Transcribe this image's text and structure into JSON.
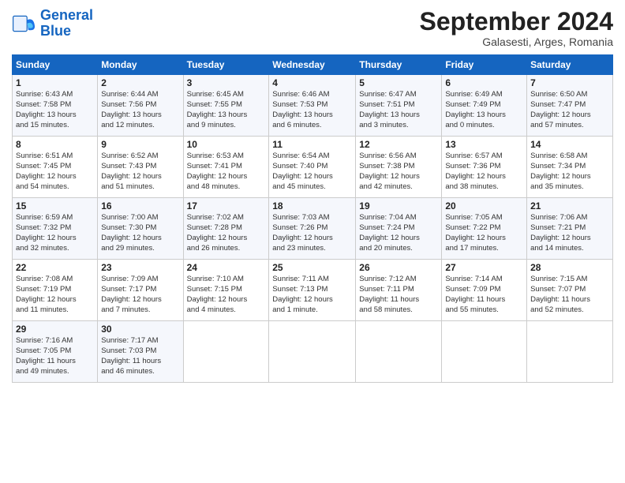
{
  "logo": {
    "line1": "General",
    "line2": "Blue"
  },
  "header": {
    "month": "September 2024",
    "location": "Galasesti, Arges, Romania"
  },
  "days_of_week": [
    "Sunday",
    "Monday",
    "Tuesday",
    "Wednesday",
    "Thursday",
    "Friday",
    "Saturday"
  ],
  "weeks": [
    [
      {
        "day": "1",
        "info": "Sunrise: 6:43 AM\nSunset: 7:58 PM\nDaylight: 13 hours\nand 15 minutes."
      },
      {
        "day": "2",
        "info": "Sunrise: 6:44 AM\nSunset: 7:56 PM\nDaylight: 13 hours\nand 12 minutes."
      },
      {
        "day": "3",
        "info": "Sunrise: 6:45 AM\nSunset: 7:55 PM\nDaylight: 13 hours\nand 9 minutes."
      },
      {
        "day": "4",
        "info": "Sunrise: 6:46 AM\nSunset: 7:53 PM\nDaylight: 13 hours\nand 6 minutes."
      },
      {
        "day": "5",
        "info": "Sunrise: 6:47 AM\nSunset: 7:51 PM\nDaylight: 13 hours\nand 3 minutes."
      },
      {
        "day": "6",
        "info": "Sunrise: 6:49 AM\nSunset: 7:49 PM\nDaylight: 13 hours\nand 0 minutes."
      },
      {
        "day": "7",
        "info": "Sunrise: 6:50 AM\nSunset: 7:47 PM\nDaylight: 12 hours\nand 57 minutes."
      }
    ],
    [
      {
        "day": "8",
        "info": "Sunrise: 6:51 AM\nSunset: 7:45 PM\nDaylight: 12 hours\nand 54 minutes."
      },
      {
        "day": "9",
        "info": "Sunrise: 6:52 AM\nSunset: 7:43 PM\nDaylight: 12 hours\nand 51 minutes."
      },
      {
        "day": "10",
        "info": "Sunrise: 6:53 AM\nSunset: 7:41 PM\nDaylight: 12 hours\nand 48 minutes."
      },
      {
        "day": "11",
        "info": "Sunrise: 6:54 AM\nSunset: 7:40 PM\nDaylight: 12 hours\nand 45 minutes."
      },
      {
        "day": "12",
        "info": "Sunrise: 6:56 AM\nSunset: 7:38 PM\nDaylight: 12 hours\nand 42 minutes."
      },
      {
        "day": "13",
        "info": "Sunrise: 6:57 AM\nSunset: 7:36 PM\nDaylight: 12 hours\nand 38 minutes."
      },
      {
        "day": "14",
        "info": "Sunrise: 6:58 AM\nSunset: 7:34 PM\nDaylight: 12 hours\nand 35 minutes."
      }
    ],
    [
      {
        "day": "15",
        "info": "Sunrise: 6:59 AM\nSunset: 7:32 PM\nDaylight: 12 hours\nand 32 minutes."
      },
      {
        "day": "16",
        "info": "Sunrise: 7:00 AM\nSunset: 7:30 PM\nDaylight: 12 hours\nand 29 minutes."
      },
      {
        "day": "17",
        "info": "Sunrise: 7:02 AM\nSunset: 7:28 PM\nDaylight: 12 hours\nand 26 minutes."
      },
      {
        "day": "18",
        "info": "Sunrise: 7:03 AM\nSunset: 7:26 PM\nDaylight: 12 hours\nand 23 minutes."
      },
      {
        "day": "19",
        "info": "Sunrise: 7:04 AM\nSunset: 7:24 PM\nDaylight: 12 hours\nand 20 minutes."
      },
      {
        "day": "20",
        "info": "Sunrise: 7:05 AM\nSunset: 7:22 PM\nDaylight: 12 hours\nand 17 minutes."
      },
      {
        "day": "21",
        "info": "Sunrise: 7:06 AM\nSunset: 7:21 PM\nDaylight: 12 hours\nand 14 minutes."
      }
    ],
    [
      {
        "day": "22",
        "info": "Sunrise: 7:08 AM\nSunset: 7:19 PM\nDaylight: 12 hours\nand 11 minutes."
      },
      {
        "day": "23",
        "info": "Sunrise: 7:09 AM\nSunset: 7:17 PM\nDaylight: 12 hours\nand 7 minutes."
      },
      {
        "day": "24",
        "info": "Sunrise: 7:10 AM\nSunset: 7:15 PM\nDaylight: 12 hours\nand 4 minutes."
      },
      {
        "day": "25",
        "info": "Sunrise: 7:11 AM\nSunset: 7:13 PM\nDaylight: 12 hours\nand 1 minute."
      },
      {
        "day": "26",
        "info": "Sunrise: 7:12 AM\nSunset: 7:11 PM\nDaylight: 11 hours\nand 58 minutes."
      },
      {
        "day": "27",
        "info": "Sunrise: 7:14 AM\nSunset: 7:09 PM\nDaylight: 11 hours\nand 55 minutes."
      },
      {
        "day": "28",
        "info": "Sunrise: 7:15 AM\nSunset: 7:07 PM\nDaylight: 11 hours\nand 52 minutes."
      }
    ],
    [
      {
        "day": "29",
        "info": "Sunrise: 7:16 AM\nSunset: 7:05 PM\nDaylight: 11 hours\nand 49 minutes."
      },
      {
        "day": "30",
        "info": "Sunrise: 7:17 AM\nSunset: 7:03 PM\nDaylight: 11 hours\nand 46 minutes."
      },
      {
        "day": "",
        "info": ""
      },
      {
        "day": "",
        "info": ""
      },
      {
        "day": "",
        "info": ""
      },
      {
        "day": "",
        "info": ""
      },
      {
        "day": "",
        "info": ""
      }
    ]
  ]
}
